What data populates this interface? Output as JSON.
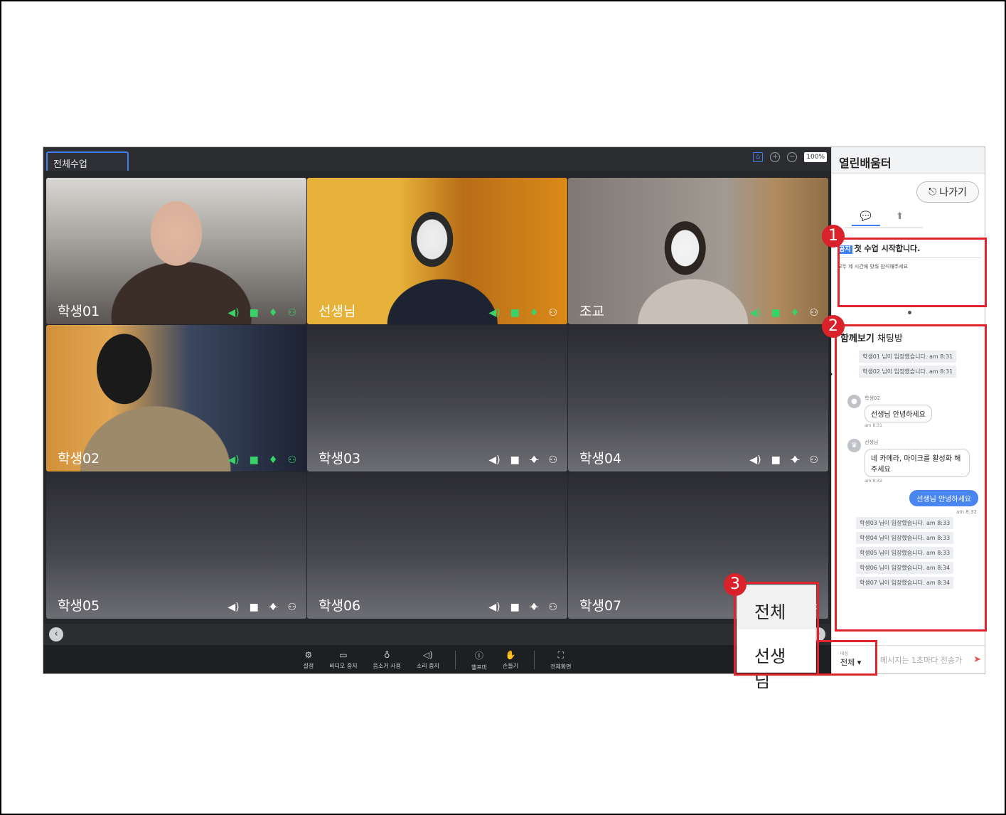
{
  "main": {
    "tab_label": "전체수업",
    "zoom": "100%",
    "participants": [
      {
        "name": "학생01"
      },
      {
        "name": "선생님"
      },
      {
        "name": "조교"
      },
      {
        "name": "학생02"
      },
      {
        "name": "학생03"
      },
      {
        "name": "학생04"
      },
      {
        "name": "학생05"
      },
      {
        "name": "학생06"
      },
      {
        "name": "학생07"
      }
    ],
    "toolbar": [
      {
        "label": "설정",
        "icon": "gear-icon"
      },
      {
        "label": "비디오 중지",
        "icon": "video-icon"
      },
      {
        "label": "음소거 사용",
        "icon": "mic-icon"
      },
      {
        "label": "소리 중지",
        "icon": "speaker-icon"
      },
      {
        "label": "헬프미",
        "icon": "help-icon"
      },
      {
        "label": "손들기",
        "icon": "hand-icon"
      },
      {
        "label": "전체화면",
        "icon": "fullscreen-icon"
      }
    ]
  },
  "sidebar": {
    "title": "열린배움터",
    "exit_label": "나가기",
    "notice": {
      "badge": "공지",
      "title": "첫 수업 시작합니다.",
      "body": "모두 제 시간에 맞춰 참석해주세요"
    },
    "chat": {
      "title_bold": "함께보기",
      "title_rest": " 채팅방",
      "system_top": [
        "학생01 님이 입장했습니다. am 8:31",
        "학생02 님이 입장했습니다. am 8:31"
      ],
      "msg1": {
        "name": "학생02",
        "text": "선생님 안녕하세요",
        "time": "am 8:31"
      },
      "msg2": {
        "name": "선생님",
        "text": "네 카메라, 마이크를 활성화 해주세요",
        "time": "am 8:32"
      },
      "mine": {
        "text": "선생님 안녕하세요",
        "time": "am 8:32"
      },
      "system_bottom": [
        "학생03 님이 입장했습니다. am 8:33",
        "학생04 님이 입장했습니다. am 8:33",
        "학생05 님이 입장했습니다. am 8:33",
        "학생06 님이 입장했습니다. am 8:34",
        "학생07 님이 입장했습니다. am 8:34"
      ]
    },
    "input": {
      "target_label": "대상",
      "target_value": "전체",
      "placeholder": "메시지는 1초마다 전송가"
    }
  },
  "dropdown": {
    "options": [
      "전체",
      "선생님"
    ]
  },
  "callouts": [
    "1",
    "2",
    "3"
  ]
}
